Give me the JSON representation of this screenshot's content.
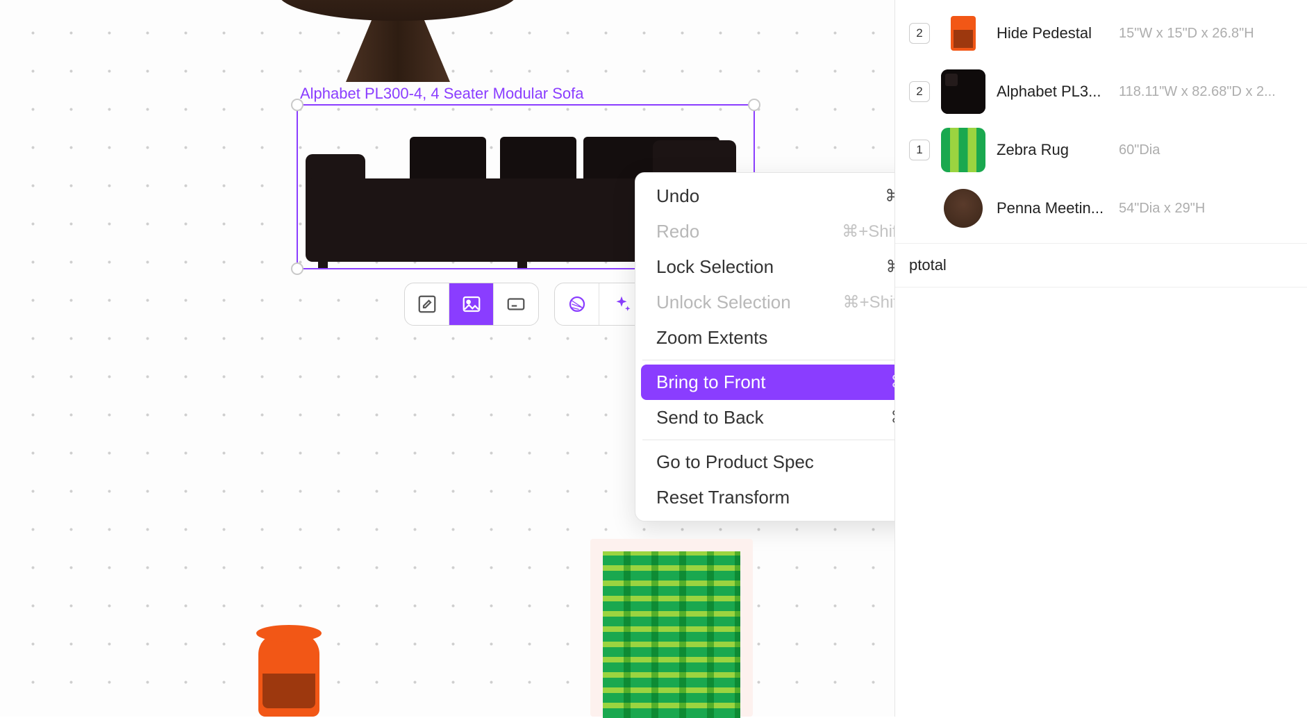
{
  "selection": {
    "label": "Alphabet PL300-4, 4 Seater Modular Sofa"
  },
  "context_menu": {
    "items": [
      {
        "label": "Undo",
        "shortcut": "⌘+Z",
        "disabled": false
      },
      {
        "label": "Redo",
        "shortcut": "⌘+Shift+Z",
        "disabled": true
      },
      {
        "label": "Lock Selection",
        "shortcut": "⌘+L",
        "disabled": false
      },
      {
        "label": "Unlock Selection",
        "shortcut": "⌘+Shift+L",
        "disabled": true
      },
      {
        "label": "Zoom Extents",
        "shortcut": "",
        "disabled": false
      },
      {
        "separator": true
      },
      {
        "label": "Bring to Front",
        "shortcut": "⌘+[",
        "highlight": true
      },
      {
        "label": "Send to Back",
        "shortcut": "⌘+]",
        "disabled": false
      },
      {
        "separator": true
      },
      {
        "label": "Go to Product Spec",
        "shortcut": "",
        "disabled": false
      },
      {
        "label": "Reset Transform",
        "shortcut": "",
        "disabled": false
      }
    ]
  },
  "sidebar": {
    "items": [
      {
        "qty": "2",
        "name": "Hide Pedestal",
        "dims": "15\"W x 15\"D x 26.8\"H",
        "thumb": "orange"
      },
      {
        "qty": "2",
        "name": "Alphabet PL3...",
        "dims": "118.11\"W x 82.68\"D x 2...",
        "thumb": "black"
      },
      {
        "qty": "1",
        "name": "Zebra Rug",
        "dims": "60\"Dia",
        "thumb": "green"
      },
      {
        "qty": "",
        "name": "Penna Meetin...",
        "dims": "54\"Dia x 29\"H",
        "thumb": "wood"
      }
    ],
    "subtotal_label": "ptotal"
  },
  "toolbar": {
    "group1": [
      "edit-icon",
      "image-icon",
      "caption-icon"
    ],
    "group2": [
      "circle-icon",
      "sparkle-icon"
    ]
  }
}
